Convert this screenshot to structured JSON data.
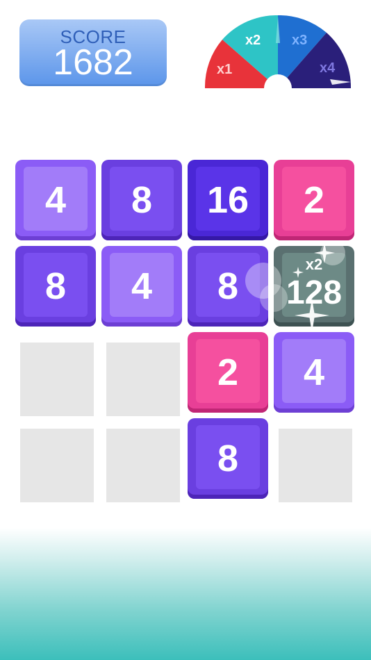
{
  "score": {
    "label": "SCORE",
    "value": "1682"
  },
  "multiplier_wheel": {
    "segments": [
      {
        "label": "x1",
        "color": "#e8333a"
      },
      {
        "label": "x2",
        "color": "#2ec4c6"
      },
      {
        "label": "x3",
        "color": "#1f6fd1"
      },
      {
        "label": "x4",
        "color": "#2a1f7a"
      }
    ]
  },
  "board": {
    "rows": 4,
    "cols": 4,
    "tiles": [
      {
        "row": 0,
        "col": 0,
        "value": "4"
      },
      {
        "row": 0,
        "col": 1,
        "value": "8"
      },
      {
        "row": 0,
        "col": 2,
        "value": "16"
      },
      {
        "row": 0,
        "col": 3,
        "value": "2"
      },
      {
        "row": 1,
        "col": 0,
        "value": "8"
      },
      {
        "row": 1,
        "col": 1,
        "value": "4"
      },
      {
        "row": 1,
        "col": 2,
        "value": "8"
      },
      {
        "row": 1,
        "col": 3,
        "value": "128",
        "badge": "x2"
      },
      {
        "row": 2,
        "col": 2,
        "value": "2"
      },
      {
        "row": 2,
        "col": 3,
        "value": "4"
      },
      {
        "row": 3,
        "col": 2,
        "value": "8"
      }
    ]
  }
}
